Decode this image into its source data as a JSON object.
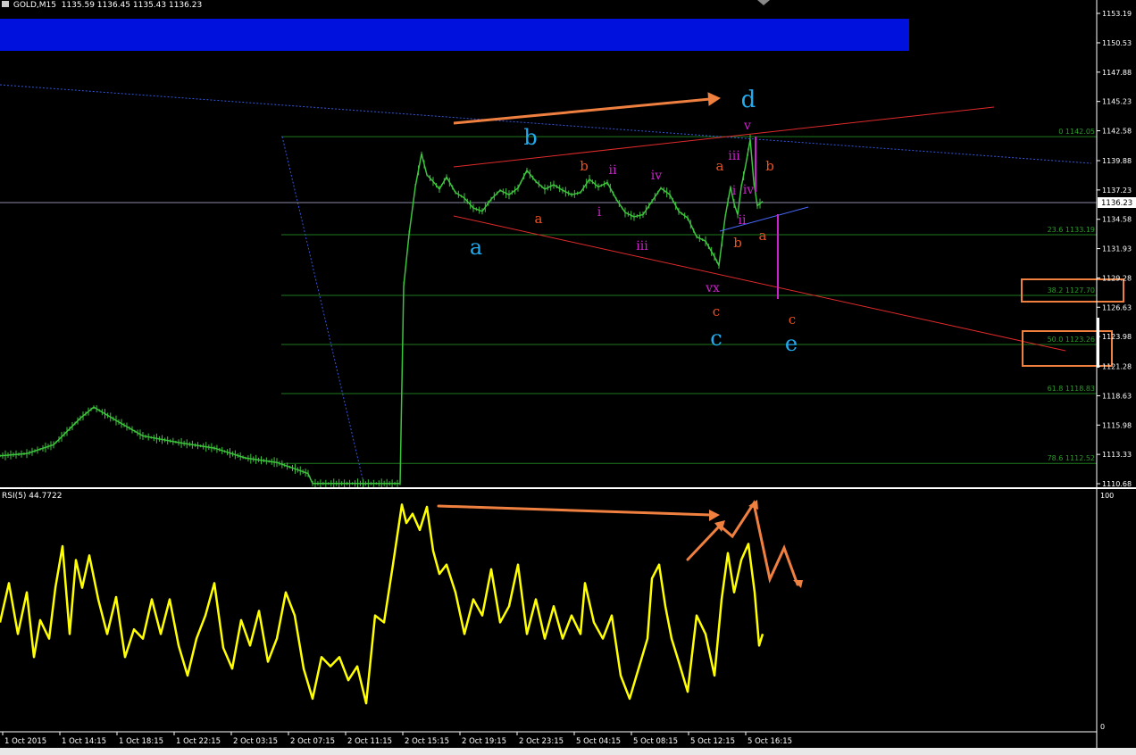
{
  "header": {
    "symbol_timeframe": "GOLD,M15",
    "open": "1135.59",
    "high": "1136.45",
    "low": "1135.43",
    "close": "1136.23"
  },
  "rsi_header": {
    "label": "RSI(5)",
    "value": "44.7722"
  },
  "colors": {
    "background": "#000000",
    "price": "#3dc43d",
    "rsi": "#ffff00",
    "axis": "#ffffff",
    "blue_zone": "#0010dd",
    "fib": "#1e7a1e",
    "channel": "#e02a2a",
    "annotation_orange": "#f08040",
    "magenta": "#cc22cc",
    "wave_blue": "#22aaee"
  },
  "chart_data": [
    {
      "type": "line",
      "title": "GOLD,M15",
      "ylabel": "",
      "xlabel": "",
      "ylim": [
        1110.68,
        1153.19
      ],
      "y_ticks": [
        "1153.19",
        "1150.53",
        "1147.88",
        "1145.23",
        "1142.58",
        "1139.88",
        "1137.23",
        "1134.58",
        "1131.93",
        "1129.28",
        "1126.63",
        "1123.98",
        "1121.28",
        "1118.63",
        "1115.98",
        "1113.33",
        "1110.68"
      ],
      "current_price": "1136.23",
      "x_ticks": [
        "1 Oct 2015",
        "1 Oct 14:15",
        "1 Oct 18:15",
        "1 Oct 22:15",
        "2 Oct 03:15",
        "2 Oct 07:15",
        "2 Oct 11:15",
        "2 Oct 15:15",
        "2 Oct 19:15",
        "2 Oct 23:15",
        "5 Oct 04:15",
        "5 Oct 08:15",
        "5 Oct 12:15",
        "5 Oct 16:15"
      ],
      "fib_levels": [
        {
          "ratio": "0",
          "price": "1142.05"
        },
        {
          "ratio": "23.6",
          "price": "1133.19"
        },
        {
          "ratio": "38.2",
          "price": "1127.70"
        },
        {
          "ratio": "50.0",
          "price": "1123.26"
        },
        {
          "ratio": "61.8",
          "price": "1118.83"
        },
        {
          "ratio": "78.6",
          "price": "1112.52"
        }
      ],
      "price_path": [
        [
          0,
          1113.2
        ],
        [
          30,
          1113.4
        ],
        [
          60,
          1114.2
        ],
        [
          90,
          1116.6
        ],
        [
          105,
          1117.6
        ],
        [
          130,
          1116.4
        ],
        [
          160,
          1115.0
        ],
        [
          200,
          1114.4
        ],
        [
          240,
          1113.9
        ],
        [
          275,
          1113.0
        ],
        [
          310,
          1112.6
        ],
        [
          345,
          1111.6
        ],
        [
          350,
          1110.7
        ],
        [
          448,
          1110.7
        ],
        [
          452,
          1128.5
        ],
        [
          458,
          1133.2
        ],
        [
          465,
          1137.5
        ],
        [
          472,
          1140.5
        ],
        [
          478,
          1138.6
        ],
        [
          485,
          1138.0
        ],
        [
          492,
          1137.3
        ],
        [
          500,
          1138.4
        ],
        [
          510,
          1137.0
        ],
        [
          520,
          1136.5
        ],
        [
          530,
          1135.6
        ],
        [
          540,
          1135.3
        ],
        [
          550,
          1136.4
        ],
        [
          560,
          1137.2
        ],
        [
          570,
          1136.8
        ],
        [
          580,
          1137.4
        ],
        [
          590,
          1139.0
        ],
        [
          600,
          1138.0
        ],
        [
          610,
          1137.3
        ],
        [
          620,
          1137.7
        ],
        [
          630,
          1137.2
        ],
        [
          640,
          1136.8
        ],
        [
          650,
          1137.0
        ],
        [
          660,
          1138.2
        ],
        [
          670,
          1137.5
        ],
        [
          680,
          1137.9
        ],
        [
          690,
          1136.4
        ],
        [
          700,
          1135.2
        ],
        [
          710,
          1134.8
        ],
        [
          720,
          1135.0
        ],
        [
          730,
          1136.2
        ],
        [
          740,
          1137.4
        ],
        [
          750,
          1136.8
        ],
        [
          760,
          1135.3
        ],
        [
          770,
          1134.7
        ],
        [
          780,
          1133.0
        ],
        [
          790,
          1132.6
        ],
        [
          800,
          1131.2
        ],
        [
          805,
          1130.4
        ],
        [
          812,
          1134.8
        ],
        [
          818,
          1137.5
        ],
        [
          822,
          1136.0
        ],
        [
          826,
          1135.0
        ],
        [
          830,
          1137.5
        ],
        [
          835,
          1139.5
        ],
        [
          840,
          1141.8
        ],
        [
          844,
          1138.0
        ],
        [
          848,
          1135.8
        ],
        [
          854,
          1136.2
        ]
      ],
      "wave_labels": [
        {
          "text": "a",
          "color": "#22aaee"
        },
        {
          "text": "b",
          "color": "#22aaee"
        },
        {
          "text": "c",
          "color": "#22aaee"
        },
        {
          "text": "d",
          "color": "#22aaee"
        },
        {
          "text": "e",
          "color": "#22aaee"
        },
        {
          "text": "a",
          "color": "#f05020"
        },
        {
          "text": "b",
          "color": "#f05020"
        },
        {
          "text": "c",
          "color": "#f05020"
        },
        {
          "text": "a",
          "color": "#f05020"
        },
        {
          "text": "b",
          "color": "#f05020"
        },
        {
          "text": "a",
          "color": "#f05020"
        },
        {
          "text": "b",
          "color": "#f05020"
        },
        {
          "text": "c",
          "color": "#f05020"
        },
        {
          "text": "i",
          "color": "#cc22cc"
        },
        {
          "text": "ii",
          "color": "#cc22cc"
        },
        {
          "text": "iii",
          "color": "#cc22cc"
        },
        {
          "text": "iv",
          "color": "#cc22cc"
        },
        {
          "text": "vx",
          "color": "#cc22cc"
        },
        {
          "text": "i",
          "color": "#cc22cc"
        },
        {
          "text": "ii",
          "color": "#cc22cc"
        },
        {
          "text": "iii",
          "color": "#cc22cc"
        },
        {
          "text": "iv",
          "color": "#cc22cc"
        },
        {
          "text": "v",
          "color": "#cc22cc"
        }
      ]
    },
    {
      "type": "line",
      "title": "RSI(5) 44.7722",
      "ylim": [
        0,
        100
      ],
      "y_ticks": [
        "100",
        "0"
      ],
      "rsi_path": [
        [
          0,
          45
        ],
        [
          10,
          62
        ],
        [
          20,
          40
        ],
        [
          30,
          58
        ],
        [
          38,
          30
        ],
        [
          45,
          46
        ],
        [
          55,
          38
        ],
        [
          62,
          60
        ],
        [
          70,
          78
        ],
        [
          78,
          40
        ],
        [
          85,
          72
        ],
        [
          92,
          60
        ],
        [
          100,
          74
        ],
        [
          110,
          55
        ],
        [
          120,
          40
        ],
        [
          130,
          56
        ],
        [
          140,
          30
        ],
        [
          150,
          42
        ],
        [
          160,
          38
        ],
        [
          170,
          55
        ],
        [
          180,
          40
        ],
        [
          190,
          55
        ],
        [
          200,
          35
        ],
        [
          210,
          22
        ],
        [
          220,
          38
        ],
        [
          230,
          48
        ],
        [
          240,
          62
        ],
        [
          250,
          34
        ],
        [
          260,
          25
        ],
        [
          270,
          46
        ],
        [
          280,
          35
        ],
        [
          290,
          50
        ],
        [
          300,
          28
        ],
        [
          310,
          38
        ],
        [
          320,
          58
        ],
        [
          330,
          48
        ],
        [
          340,
          25
        ],
        [
          350,
          12
        ],
        [
          360,
          30
        ],
        [
          370,
          26
        ],
        [
          380,
          30
        ],
        [
          390,
          20
        ],
        [
          400,
          26
        ],
        [
          410,
          10
        ],
        [
          420,
          48
        ],
        [
          430,
          45
        ],
        [
          440,
          70
        ],
        [
          450,
          96
        ],
        [
          455,
          88
        ],
        [
          462,
          92
        ],
        [
          470,
          85
        ],
        [
          478,
          95
        ],
        [
          485,
          76
        ],
        [
          492,
          66
        ],
        [
          500,
          70
        ],
        [
          510,
          58
        ],
        [
          520,
          40
        ],
        [
          530,
          55
        ],
        [
          540,
          48
        ],
        [
          550,
          68
        ],
        [
          560,
          45
        ],
        [
          570,
          52
        ],
        [
          580,
          70
        ],
        [
          590,
          40
        ],
        [
          600,
          55
        ],
        [
          610,
          38
        ],
        [
          620,
          52
        ],
        [
          630,
          38
        ],
        [
          640,
          48
        ],
        [
          650,
          40
        ],
        [
          655,
          62
        ],
        [
          665,
          45
        ],
        [
          675,
          38
        ],
        [
          685,
          48
        ],
        [
          695,
          22
        ],
        [
          705,
          12
        ],
        [
          715,
          25
        ],
        [
          725,
          38
        ],
        [
          730,
          64
        ],
        [
          738,
          70
        ],
        [
          745,
          52
        ],
        [
          752,
          38
        ],
        [
          760,
          28
        ],
        [
          770,
          15
        ],
        [
          780,
          48
        ],
        [
          790,
          40
        ],
        [
          800,
          22
        ],
        [
          808,
          55
        ],
        [
          815,
          75
        ],
        [
          822,
          58
        ],
        [
          830,
          72
        ],
        [
          838,
          79
        ],
        [
          845,
          58
        ],
        [
          850,
          35
        ],
        [
          854,
          40
        ]
      ]
    }
  ]
}
